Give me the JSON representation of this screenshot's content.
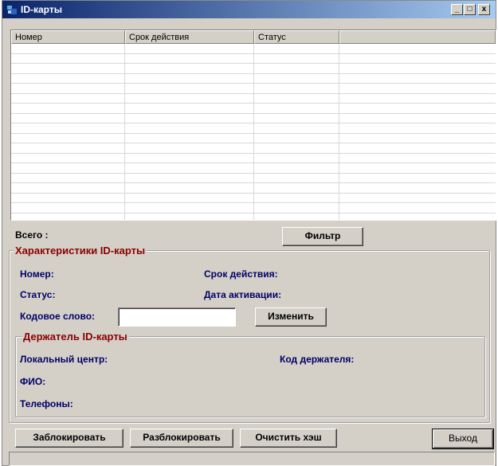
{
  "window": {
    "title": "ID-карты",
    "minimize": "_",
    "maximize": "□",
    "close": "x"
  },
  "grid": {
    "columns": [
      "Номер",
      "Срок действия",
      "Статус",
      ""
    ],
    "rows": 20
  },
  "total_label": "Всего :",
  "filter_button": "Фильтр",
  "card_group": {
    "legend": "Характеристики ID-карты",
    "number_label": "Номер:",
    "expiry_label": "Срок действия:",
    "status_label": "Статус:",
    "activation_label": "Дата активации:",
    "codeword_label": "Кодовое слово:",
    "codeword_value": "",
    "change_button": "Изменить"
  },
  "holder_group": {
    "legend": "Держатель ID-карты",
    "local_center_label": "Локальный центр:",
    "holder_code_label": "Код держателя:",
    "fio_label": "ФИО:",
    "phones_label": "Телефоны:"
  },
  "footer": {
    "block_button": "Заблокировать",
    "unblock_button": "Разблокировать",
    "clear_cache_button": "Очистить хэш",
    "exit_button": "Выход"
  }
}
